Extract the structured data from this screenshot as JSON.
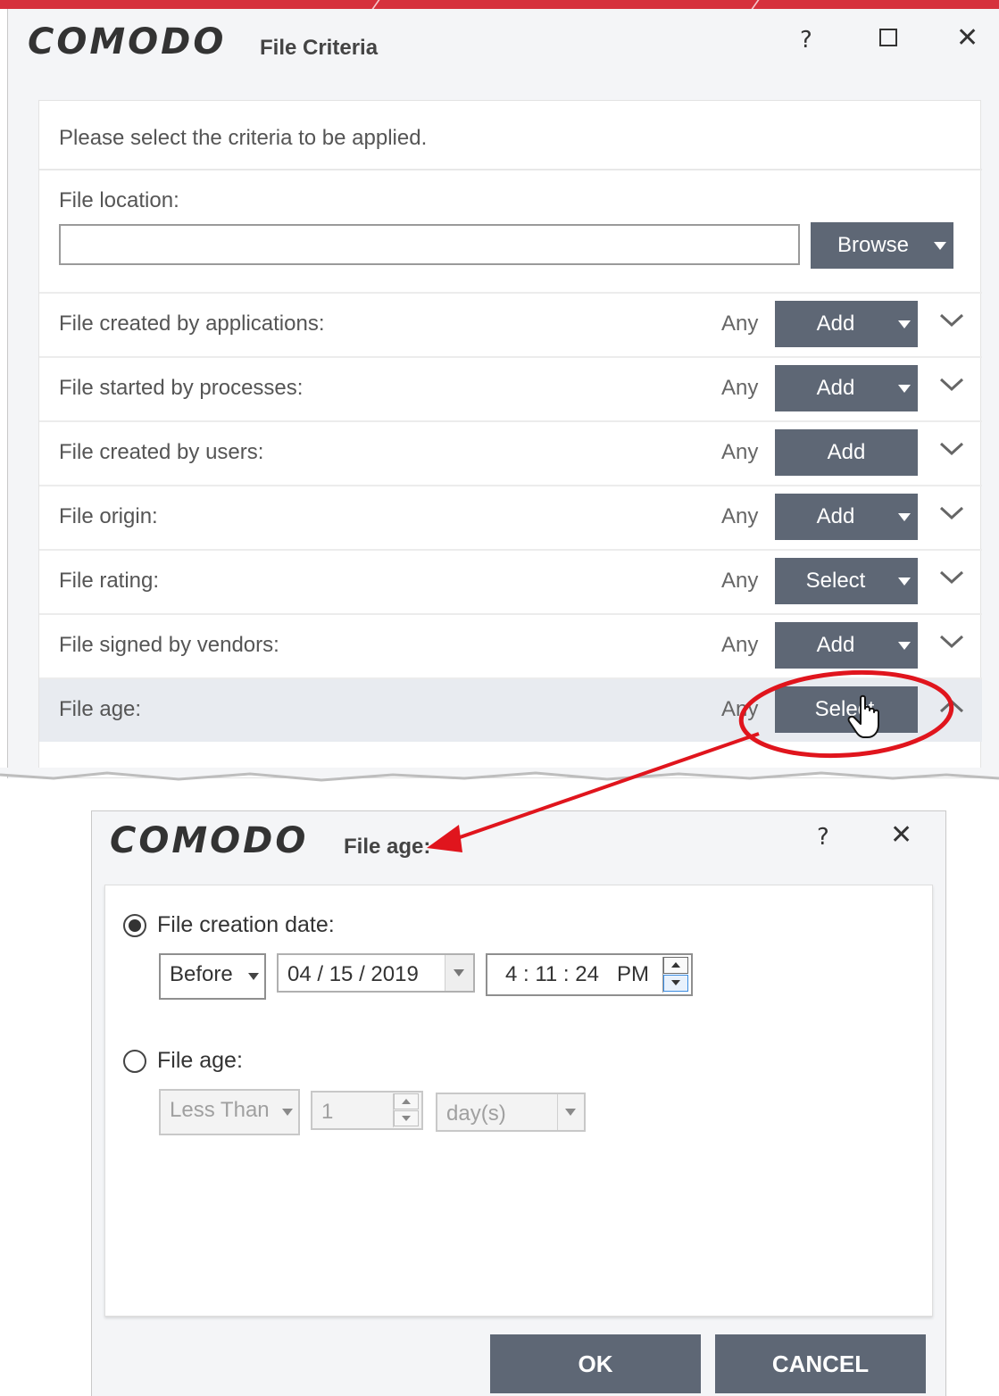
{
  "main_window": {
    "brand": "COMODO",
    "title": "File Criteria",
    "help_glyph": "?",
    "close_glyph": "✕",
    "intro": "Please select the criteria to be applied.",
    "location_label": "File location:",
    "location_value": "",
    "browse_label": "Browse",
    "rows": [
      {
        "label": "File created by applications:",
        "value": "Any",
        "button": "Add",
        "has_caret": true,
        "expanded": false
      },
      {
        "label": "File started by processes:",
        "value": "Any",
        "button": "Add",
        "has_caret": true,
        "expanded": false
      },
      {
        "label": "File created by users:",
        "value": "Any",
        "button": "Add",
        "has_caret": false,
        "expanded": false
      },
      {
        "label": "File origin:",
        "value": "Any",
        "button": "Add",
        "has_caret": true,
        "expanded": false
      },
      {
        "label": "File rating:",
        "value": "Any",
        "button": "Select",
        "has_caret": true,
        "expanded": false
      },
      {
        "label": "File signed by vendors:",
        "value": "Any",
        "button": "Add",
        "has_caret": true,
        "expanded": false
      },
      {
        "label": "File age:",
        "value": "Any",
        "button": "Select",
        "has_caret": false,
        "expanded": true
      }
    ]
  },
  "age_dialog": {
    "brand": "COMODO",
    "title": "File age:",
    "help_glyph": "?",
    "close_glyph": "✕",
    "option_creation_date": {
      "label": "File creation date:",
      "selected": true,
      "comparison": "Before",
      "date": "04 / 15 / 2019",
      "time": "4 : 11 : 24   PM"
    },
    "option_file_age": {
      "label": "File age:",
      "selected": false,
      "comparison": "Less Than",
      "amount": "1",
      "unit": "day(s)"
    },
    "ok_label": "OK",
    "cancel_label": "CANCEL"
  },
  "colors": {
    "button_dark": "#5e6775",
    "annotation_red": "#e0151d",
    "top_strip": "#d6313d"
  }
}
